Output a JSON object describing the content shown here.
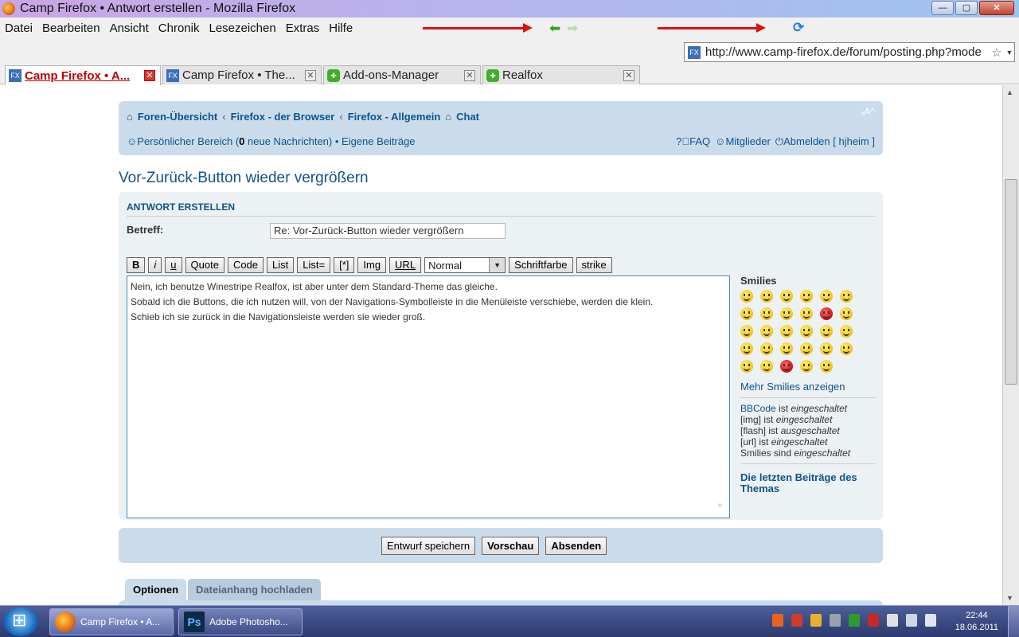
{
  "window": {
    "title": "Camp Firefox • Antwort erstellen - Mozilla Firefox",
    "min": "—",
    "max": "▢",
    "close": "✕"
  },
  "menu": [
    "Datei",
    "Bearbeiten",
    "Ansicht",
    "Chronik",
    "Lesezeichen",
    "Extras",
    "Hilfe"
  ],
  "nav": {
    "back_icon": "⬅",
    "forward_icon": "➡",
    "reload_icon": "⟳"
  },
  "urlbar": {
    "site_icon": "FX",
    "url": "http://www.camp-firefox.de/forum/posting.php?mode",
    "star": "☆",
    "drop": "▼"
  },
  "tabs": [
    {
      "label": "Camp Firefox • A...",
      "icon": "FX",
      "close": "✕"
    },
    {
      "label": "Camp Firefox • The...",
      "icon": "FX",
      "close": "✕"
    },
    {
      "label": "Add-ons-Manager",
      "icon": "✚",
      "close": "✕"
    },
    {
      "label": "Realfox",
      "icon": "✚",
      "close": "✕"
    }
  ],
  "forum": {
    "crumbs": [
      "Foren-Übersicht",
      "Firefox - der Browser",
      "Firefox - Allgemein",
      "Chat"
    ],
    "crumb_sep": "‹",
    "fontsize": "ᵥA^",
    "personal": "Persönlicher Bereich (",
    "new_count": "0",
    "new_msgs": " neue Nachrichten) • Eigene Beiträge",
    "faq": "FAQ",
    "members": "Mitglieder",
    "logout": "Abmelden [ hjheim ]",
    "topic_title": "Vor-Zurück-Button wieder vergrößern",
    "post_head": "ANTWORT ERSTELLEN",
    "subject_label": "Betreff:",
    "subject_value": "Re: Vor-Zurück-Button wieder vergrößern",
    "toolbar": [
      "B",
      "i",
      "u",
      "Quote",
      "Code",
      "List",
      "List=",
      "[*]",
      "Img",
      "URL"
    ],
    "size_select": "Normal",
    "color_button": "Schriftfarbe",
    "strike_button": "strike",
    "message_lines": [
      "Nein, ich benutze Winestripe Realfox, ist aber unter dem Standard-Theme das gleiche.",
      "Sobald ich die Buttons, die ich nutzen will, von der Navigations-Symbolleiste in die Menüleiste verschiebe, werden die klein.",
      "Schieb ich sie zurück in die Navigationsleiste werden sie wieder groß."
    ],
    "resize_grip": "⠶",
    "smilies_title": "Smilies",
    "more_smilies": "Mehr Smilies anzeigen",
    "bbcode_link": "BBCode",
    "ist": " ist ",
    "sind": " sind ",
    "eingeschaltet": "eingeschaltet",
    "ausgeschaltet": "ausgeschaltet",
    "img": "[img]",
    "flash": "[flash]",
    "url": "[url]",
    "smilies_word": "Smilies",
    "latest": "Die letzten Beiträge des Themas",
    "save_draft": "Entwurf speichern",
    "preview": "Vorschau",
    "submit": "Absenden",
    "tab_options": "Optionen",
    "tab_upload": "Dateianhang hochladen"
  },
  "taskbar": {
    "firefox": "Camp Firefox • A...",
    "photoshop": "Adobe Photosho...",
    "ps_icon": "Ps",
    "time": "22:44",
    "date": "18.06.2011"
  },
  "colors": {
    "accent": "#105289",
    "panel": "#cadceb",
    "post_bg": "#ecf1f3"
  }
}
